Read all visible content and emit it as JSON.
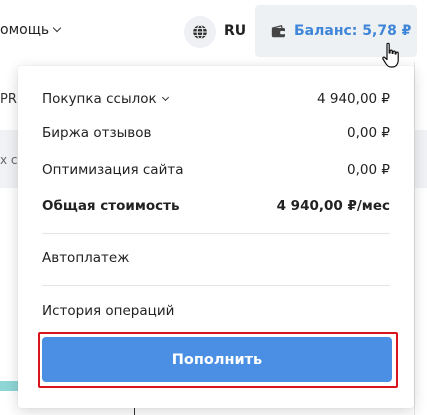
{
  "topbar": {
    "help_label": "омощь",
    "language": "RU",
    "balance": "Баланс: 5,78 ₽"
  },
  "background": {
    "row1_fragment": "PR",
    "row2_fragment": "х с"
  },
  "dropdown": {
    "lines": [
      {
        "label": "Покупка ссылок",
        "amount": "4 940,00 ₽"
      },
      {
        "label": "Биржа отзывов",
        "amount": "0,00 ₽"
      },
      {
        "label": "Оптимизация сайта",
        "amount": "0,00 ₽"
      }
    ],
    "total": {
      "label": "Общая стоимость",
      "amount": "4 940,00 ₽/мес"
    },
    "autopay": "Автоплатеж",
    "history": "История операций",
    "topup_button": "Пополнить"
  },
  "colors": {
    "accent": "#4a8fe3",
    "balance_text": "#3f86d8",
    "highlight": "#d9141e"
  },
  "icons": [
    "chevron-down-icon",
    "globe-icon",
    "wallet-icon",
    "hand-cursor-icon"
  ]
}
